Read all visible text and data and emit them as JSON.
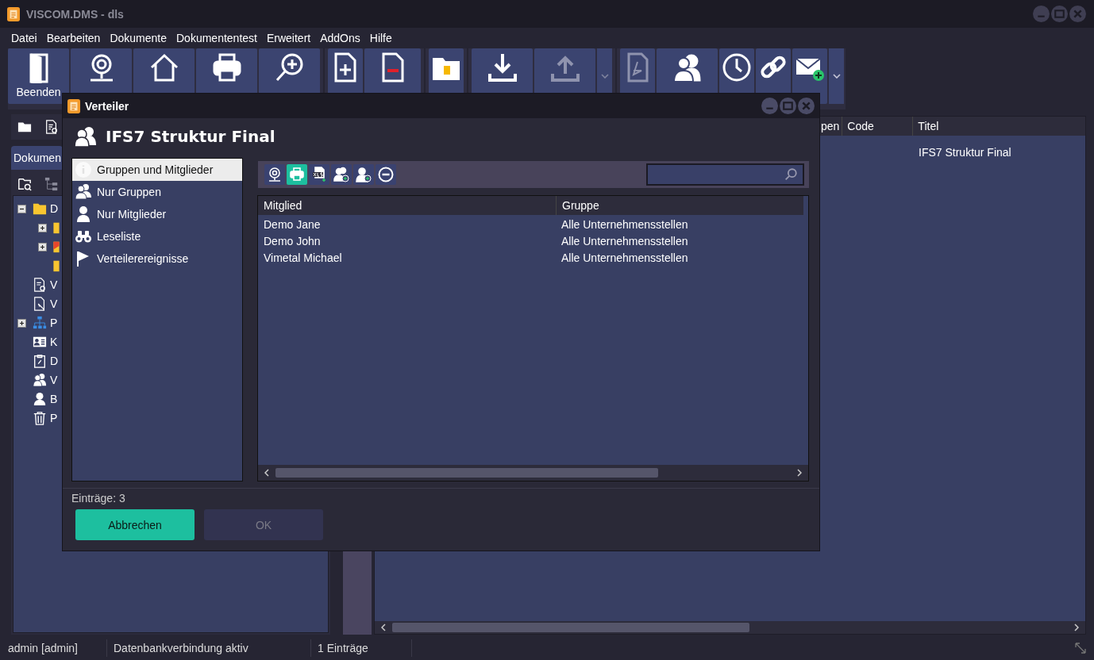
{
  "window": {
    "title": "VISCOM.DMS - dls"
  },
  "menu": [
    "Datei",
    "Bearbeiten",
    "Dokumente",
    "Dokumententest",
    "Erweitert",
    "AddOns",
    "Hilfe"
  ],
  "toolbar": [
    {
      "kind": "button",
      "label": "Beenden",
      "disabled": false
    },
    {
      "kind": "button",
      "disabled": false
    },
    {
      "kind": "button",
      "disabled": false
    },
    {
      "kind": "button",
      "disabled": false
    },
    {
      "kind": "button",
      "disabled": false
    },
    {
      "kind": "separator"
    },
    {
      "kind": "button",
      "disabled": false
    },
    {
      "kind": "button",
      "disabled": false
    },
    {
      "kind": "separator"
    },
    {
      "kind": "button",
      "disabled": false
    },
    {
      "kind": "separator"
    },
    {
      "kind": "button",
      "disabled": false
    },
    {
      "kind": "button",
      "disabled": true
    },
    {
      "kind": "dropdown",
      "disabled": true
    },
    {
      "kind": "separator"
    },
    {
      "kind": "button",
      "disabled": true
    },
    {
      "kind": "button",
      "disabled": false
    },
    {
      "kind": "button",
      "disabled": false
    },
    {
      "kind": "button",
      "disabled": false
    },
    {
      "kind": "button",
      "disabled": false
    },
    {
      "kind": "dropdown",
      "disabled": false
    }
  ],
  "left_panel": {
    "tab": "Dokumen",
    "tree": [
      {
        "label": "D",
        "expanded": true,
        "children": [
          {
            "kind": "branch",
            "expanded": false
          },
          {
            "kind": "branch",
            "expanded": false
          },
          {
            "kind": "leaf"
          }
        ]
      },
      {
        "label": "V"
      },
      {
        "label": "V"
      },
      {
        "label": "P",
        "expanded": false
      },
      {
        "label": "K"
      },
      {
        "label": "D"
      },
      {
        "label": "V"
      },
      {
        "label": "B"
      },
      {
        "label": "P"
      }
    ]
  },
  "documents_table": {
    "columns": [
      "pen",
      "Code",
      "Titel"
    ],
    "rows": [
      {
        "title": "IFS7 Struktur Final"
      }
    ]
  },
  "status_bar": [
    "admin [admin]",
    "Datenbankverbindung aktiv",
    "1 Einträge"
  ],
  "dialog": {
    "title": "Verteiler",
    "heading": "IFS7 Struktur Final",
    "nav": [
      {
        "label": "Gruppen und Mitglieder",
        "selected": true
      },
      {
        "label": "Nur Gruppen",
        "selected": false
      },
      {
        "label": "Nur Mitglieder",
        "selected": false
      },
      {
        "label": "Leseliste",
        "selected": false
      },
      {
        "label": "Verteilerereignisse",
        "selected": false
      }
    ],
    "toolbar": [
      {
        "highlighted": false
      },
      {
        "highlighted": true
      },
      {
        "highlighted": false
      },
      {
        "highlighted": false
      },
      {
        "highlighted": false
      },
      {
        "highlighted": false
      }
    ],
    "table": {
      "columns": [
        "Mitglied",
        "Gruppe"
      ],
      "rows": [
        [
          "Demo Jane",
          "Alle Unternehmensstellen"
        ],
        [
          "Demo John",
          "Alle Unternehmensstellen"
        ],
        [
          "Vimetal Michael",
          "Alle Unternehmensstellen"
        ]
      ]
    },
    "count": "Einträge: 3",
    "buttons": [
      {
        "label": "Abbrechen",
        "kind": "primary",
        "disabled": false
      },
      {
        "label": "OK",
        "kind": "secondary",
        "disabled": true
      }
    ]
  }
}
